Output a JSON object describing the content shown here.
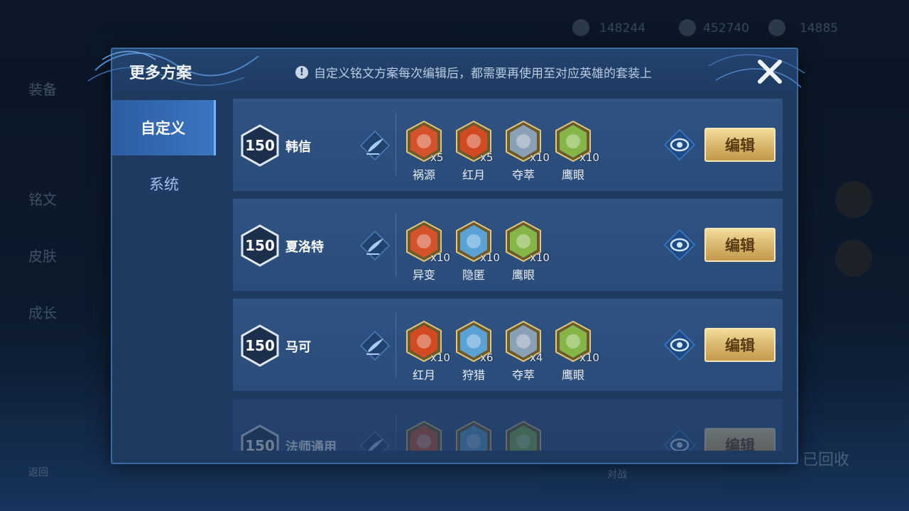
{
  "background": {
    "resources": [
      "148244",
      "452740",
      "14885"
    ],
    "side_labels": [
      "装备",
      "铭文",
      "皮肤",
      "成长"
    ],
    "bottom_right": "已回收",
    "bottom_left": "返回",
    "bottom_mid": "对战"
  },
  "dialog": {
    "title": "更多方案",
    "notice": "自定义铭文方案每次编辑后，都需要再使用至对应英雄的套装上",
    "notice_icon": "!",
    "close_icon": "close-x"
  },
  "tabs": [
    {
      "label": "自定义",
      "active": true
    },
    {
      "label": "系统",
      "active": false
    }
  ],
  "plans": [
    {
      "level": "150",
      "hero": "韩信",
      "edit_label": "编辑",
      "runes": [
        {
          "name": "祸源",
          "count": "x5",
          "color": "#d4532b"
        },
        {
          "name": "红月",
          "count": "x5",
          "color": "#d24a22"
        },
        {
          "name": "夺萃",
          "count": "x10",
          "color": "#8aa0b5"
        },
        {
          "name": "鹰眼",
          "count": "x10",
          "color": "#86b548"
        }
      ]
    },
    {
      "level": "150",
      "hero": "夏洛特",
      "edit_label": "编辑",
      "runes": [
        {
          "name": "异变",
          "count": "x10",
          "color": "#d4532b"
        },
        {
          "name": "隐匿",
          "count": "x10",
          "color": "#5aa2d6"
        },
        {
          "name": "鹰眼",
          "count": "x10",
          "color": "#86b548"
        }
      ]
    },
    {
      "level": "150",
      "hero": "马可",
      "edit_label": "编辑",
      "runes": [
        {
          "name": "红月",
          "count": "x10",
          "color": "#d24a22"
        },
        {
          "name": "狩猎",
          "count": "x6",
          "color": "#5aa2d6"
        },
        {
          "name": "夺萃",
          "count": "x4",
          "color": "#8aa0b5"
        },
        {
          "name": "鹰眼",
          "count": "x10",
          "color": "#86b548"
        }
      ]
    },
    {
      "level": "150",
      "hero": "法师通用",
      "edit_label": "编辑",
      "runes": [
        {
          "name": "",
          "count": "",
          "color": "#d4532b"
        },
        {
          "name": "",
          "count": "",
          "color": "#5aa2d6"
        },
        {
          "name": "",
          "count": "",
          "color": "#86b548"
        }
      ]
    }
  ]
}
